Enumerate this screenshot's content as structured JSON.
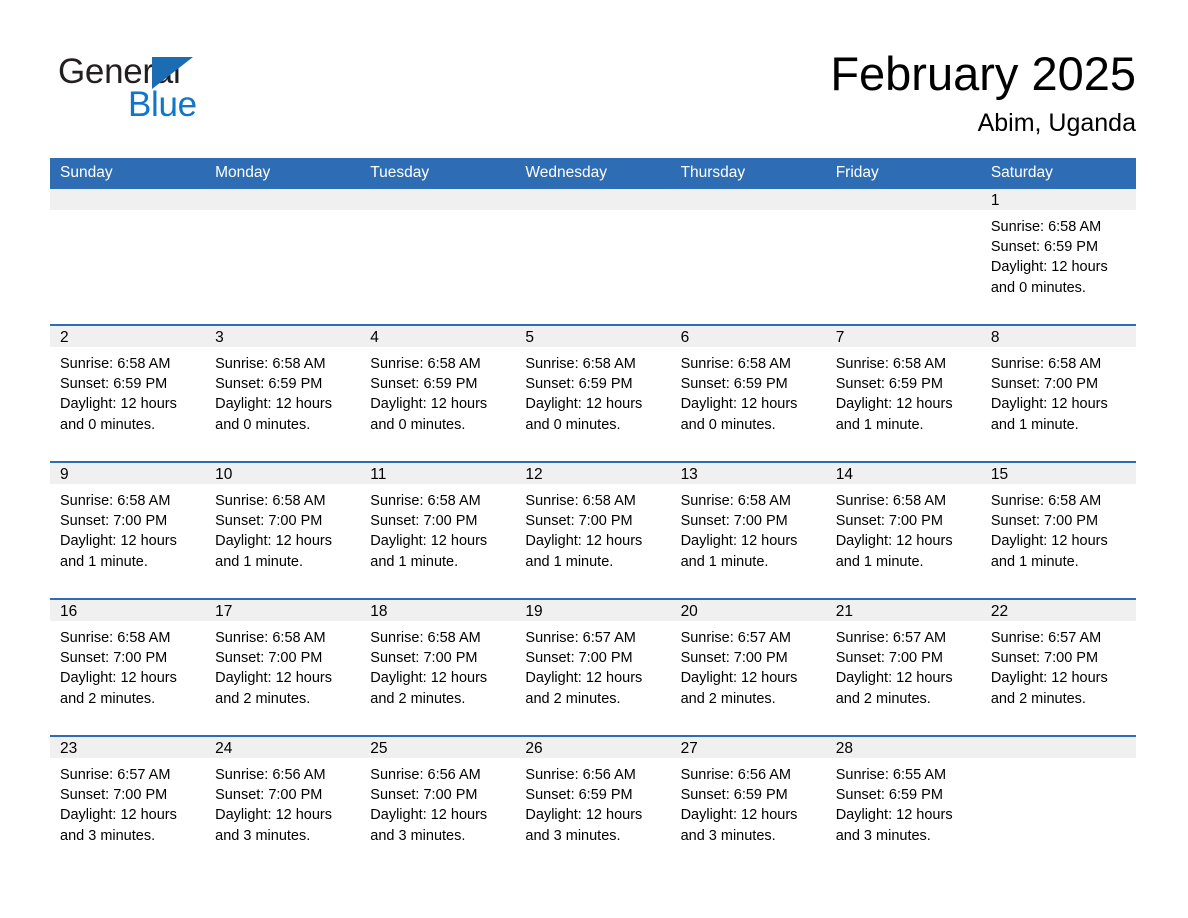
{
  "brand": {
    "name_part1": "General",
    "name_part2": "Blue",
    "triangle_color": "#1b6cb3",
    "blue_color": "#0f77c8"
  },
  "header": {
    "month_title": "February 2025",
    "location": "Abim, Uganda"
  },
  "theme": {
    "header_blue": "#2e6db4",
    "daynum_band": "#f0f0f0",
    "text": "#000000"
  },
  "weekday_headers": [
    "Sunday",
    "Monday",
    "Tuesday",
    "Wednesday",
    "Thursday",
    "Friday",
    "Saturday"
  ],
  "weeks": [
    [
      {
        "day": "",
        "empty": true
      },
      {
        "day": "",
        "empty": true
      },
      {
        "day": "",
        "empty": true
      },
      {
        "day": "",
        "empty": true
      },
      {
        "day": "",
        "empty": true
      },
      {
        "day": "",
        "empty": true
      },
      {
        "day": "1",
        "sunrise": "Sunrise: 6:58 AM",
        "sunset": "Sunset: 6:59 PM",
        "daylight": "Daylight: 12 hours and 0 minutes."
      }
    ],
    [
      {
        "day": "2",
        "sunrise": "Sunrise: 6:58 AM",
        "sunset": "Sunset: 6:59 PM",
        "daylight": "Daylight: 12 hours and 0 minutes."
      },
      {
        "day": "3",
        "sunrise": "Sunrise: 6:58 AM",
        "sunset": "Sunset: 6:59 PM",
        "daylight": "Daylight: 12 hours and 0 minutes."
      },
      {
        "day": "4",
        "sunrise": "Sunrise: 6:58 AM",
        "sunset": "Sunset: 6:59 PM",
        "daylight": "Daylight: 12 hours and 0 minutes."
      },
      {
        "day": "5",
        "sunrise": "Sunrise: 6:58 AM",
        "sunset": "Sunset: 6:59 PM",
        "daylight": "Daylight: 12 hours and 0 minutes."
      },
      {
        "day": "6",
        "sunrise": "Sunrise: 6:58 AM",
        "sunset": "Sunset: 6:59 PM",
        "daylight": "Daylight: 12 hours and 0 minutes."
      },
      {
        "day": "7",
        "sunrise": "Sunrise: 6:58 AM",
        "sunset": "Sunset: 6:59 PM",
        "daylight": "Daylight: 12 hours and 1 minute."
      },
      {
        "day": "8",
        "sunrise": "Sunrise: 6:58 AM",
        "sunset": "Sunset: 7:00 PM",
        "daylight": "Daylight: 12 hours and 1 minute."
      }
    ],
    [
      {
        "day": "9",
        "sunrise": "Sunrise: 6:58 AM",
        "sunset": "Sunset: 7:00 PM",
        "daylight": "Daylight: 12 hours and 1 minute."
      },
      {
        "day": "10",
        "sunrise": "Sunrise: 6:58 AM",
        "sunset": "Sunset: 7:00 PM",
        "daylight": "Daylight: 12 hours and 1 minute."
      },
      {
        "day": "11",
        "sunrise": "Sunrise: 6:58 AM",
        "sunset": "Sunset: 7:00 PM",
        "daylight": "Daylight: 12 hours and 1 minute."
      },
      {
        "day": "12",
        "sunrise": "Sunrise: 6:58 AM",
        "sunset": "Sunset: 7:00 PM",
        "daylight": "Daylight: 12 hours and 1 minute."
      },
      {
        "day": "13",
        "sunrise": "Sunrise: 6:58 AM",
        "sunset": "Sunset: 7:00 PM",
        "daylight": "Daylight: 12 hours and 1 minute."
      },
      {
        "day": "14",
        "sunrise": "Sunrise: 6:58 AM",
        "sunset": "Sunset: 7:00 PM",
        "daylight": "Daylight: 12 hours and 1 minute."
      },
      {
        "day": "15",
        "sunrise": "Sunrise: 6:58 AM",
        "sunset": "Sunset: 7:00 PM",
        "daylight": "Daylight: 12 hours and 1 minute."
      }
    ],
    [
      {
        "day": "16",
        "sunrise": "Sunrise: 6:58 AM",
        "sunset": "Sunset: 7:00 PM",
        "daylight": "Daylight: 12 hours and 2 minutes."
      },
      {
        "day": "17",
        "sunrise": "Sunrise: 6:58 AM",
        "sunset": "Sunset: 7:00 PM",
        "daylight": "Daylight: 12 hours and 2 minutes."
      },
      {
        "day": "18",
        "sunrise": "Sunrise: 6:58 AM",
        "sunset": "Sunset: 7:00 PM",
        "daylight": "Daylight: 12 hours and 2 minutes."
      },
      {
        "day": "19",
        "sunrise": "Sunrise: 6:57 AM",
        "sunset": "Sunset: 7:00 PM",
        "daylight": "Daylight: 12 hours and 2 minutes."
      },
      {
        "day": "20",
        "sunrise": "Sunrise: 6:57 AM",
        "sunset": "Sunset: 7:00 PM",
        "daylight": "Daylight: 12 hours and 2 minutes."
      },
      {
        "day": "21",
        "sunrise": "Sunrise: 6:57 AM",
        "sunset": "Sunset: 7:00 PM",
        "daylight": "Daylight: 12 hours and 2 minutes."
      },
      {
        "day": "22",
        "sunrise": "Sunrise: 6:57 AM",
        "sunset": "Sunset: 7:00 PM",
        "daylight": "Daylight: 12 hours and 2 minutes."
      }
    ],
    [
      {
        "day": "23",
        "sunrise": "Sunrise: 6:57 AM",
        "sunset": "Sunset: 7:00 PM",
        "daylight": "Daylight: 12 hours and 3 minutes."
      },
      {
        "day": "24",
        "sunrise": "Sunrise: 6:56 AM",
        "sunset": "Sunset: 7:00 PM",
        "daylight": "Daylight: 12 hours and 3 minutes."
      },
      {
        "day": "25",
        "sunrise": "Sunrise: 6:56 AM",
        "sunset": "Sunset: 7:00 PM",
        "daylight": "Daylight: 12 hours and 3 minutes."
      },
      {
        "day": "26",
        "sunrise": "Sunrise: 6:56 AM",
        "sunset": "Sunset: 6:59 PM",
        "daylight": "Daylight: 12 hours and 3 minutes."
      },
      {
        "day": "27",
        "sunrise": "Sunrise: 6:56 AM",
        "sunset": "Sunset: 6:59 PM",
        "daylight": "Daylight: 12 hours and 3 minutes."
      },
      {
        "day": "28",
        "sunrise": "Sunrise: 6:55 AM",
        "sunset": "Sunset: 6:59 PM",
        "daylight": "Daylight: 12 hours and 3 minutes."
      },
      {
        "day": "",
        "empty": true
      }
    ]
  ]
}
